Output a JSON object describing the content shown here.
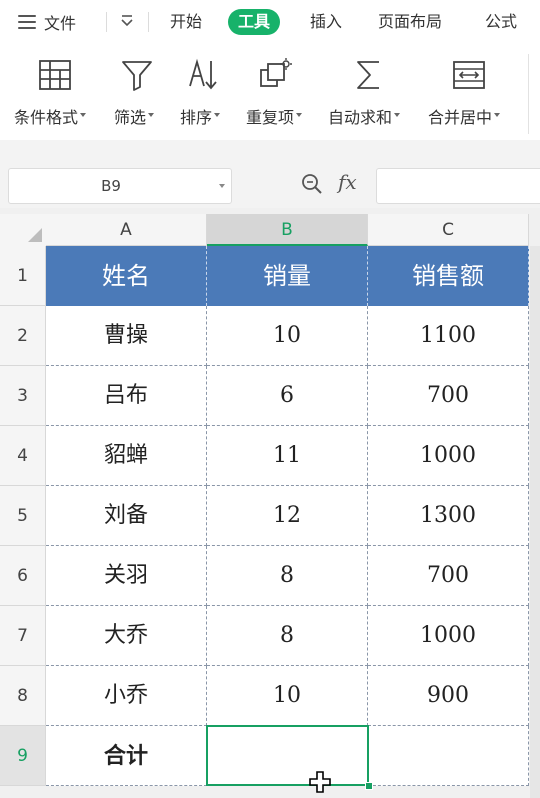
{
  "menubar": {
    "file_label": "文件",
    "tabs": [
      {
        "label": "开始",
        "active": false
      },
      {
        "label": "工具",
        "active": true
      },
      {
        "label": "插入",
        "active": false
      },
      {
        "label": "页面布局",
        "active": false
      },
      {
        "label": "公式",
        "active": false
      }
    ]
  },
  "ribbon": {
    "items": [
      {
        "label": "条件格式",
        "icon": "conditional-format-icon"
      },
      {
        "label": "筛选",
        "icon": "filter-icon"
      },
      {
        "label": "排序",
        "icon": "sort-icon"
      },
      {
        "label": "重复项",
        "icon": "duplicates-icon"
      },
      {
        "label": "自动求和",
        "icon": "sum-icon"
      },
      {
        "label": "合并居中",
        "icon": "merge-center-icon"
      }
    ]
  },
  "formula_bar": {
    "name_box": "B9",
    "fx_label": "fx",
    "formula": ""
  },
  "sheet": {
    "columns": [
      "A",
      "B",
      "C"
    ],
    "selected_column": "B",
    "selected_row": "9",
    "rows": [
      {
        "num": "1",
        "cells": [
          "姓名",
          "销量",
          "销售额"
        ]
      },
      {
        "num": "2",
        "cells": [
          "曹操",
          "10",
          "1100"
        ]
      },
      {
        "num": "3",
        "cells": [
          "吕布",
          "6",
          "700"
        ]
      },
      {
        "num": "4",
        "cells": [
          "貂蝉",
          "11",
          "1000"
        ]
      },
      {
        "num": "5",
        "cells": [
          "刘备",
          "12",
          "1300"
        ]
      },
      {
        "num": "6",
        "cells": [
          "关羽",
          "8",
          "700"
        ]
      },
      {
        "num": "7",
        "cells": [
          "大乔",
          "8",
          "1000"
        ]
      },
      {
        "num": "8",
        "cells": [
          "小乔",
          "10",
          "900"
        ]
      },
      {
        "num": "9",
        "cells": [
          "合计",
          "",
          ""
        ]
      }
    ]
  },
  "colors": {
    "accent": "#17b26a",
    "selection": "#17a062",
    "header_fill": "#4b7ab8"
  }
}
